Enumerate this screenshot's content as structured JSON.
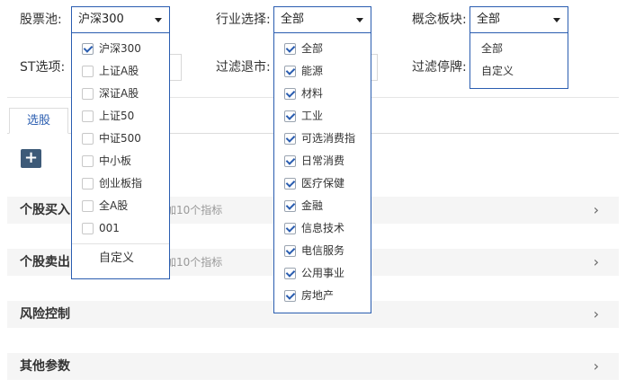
{
  "filters": {
    "pool_label": "股票池:",
    "pool_value": "沪深300",
    "industry_label": "行业选择:",
    "industry_value": "全部",
    "concept_label": "概念板块:",
    "concept_value": "全部",
    "st_label": "ST选项:",
    "delist_label": "过滤退市:",
    "suspend_label": "过滤停牌:"
  },
  "pool_menu": {
    "options": [
      {
        "label": "沪深300",
        "checked": true
      },
      {
        "label": "上证A股",
        "checked": false
      },
      {
        "label": "深证A股",
        "checked": false
      },
      {
        "label": "上证50",
        "checked": false
      },
      {
        "label": "中证500",
        "checked": false
      },
      {
        "label": "中小板",
        "checked": false
      },
      {
        "label": "创业板指",
        "checked": false
      },
      {
        "label": "全A股",
        "checked": false
      },
      {
        "label": "001",
        "checked": false
      }
    ],
    "custom_label": "自定义"
  },
  "industry_menu": {
    "options": [
      {
        "label": "全部",
        "checked": true
      },
      {
        "label": "能源",
        "checked": true
      },
      {
        "label": "材料",
        "checked": true
      },
      {
        "label": "工业",
        "checked": true
      },
      {
        "label": "可选消费指",
        "checked": true
      },
      {
        "label": "日常消费",
        "checked": true
      },
      {
        "label": "医疗保健",
        "checked": true
      },
      {
        "label": "金融",
        "checked": true
      },
      {
        "label": "信息技术",
        "checked": true
      },
      {
        "label": "电信服务",
        "checked": true
      },
      {
        "label": "公用事业",
        "checked": true
      },
      {
        "label": "房地产",
        "checked": true
      }
    ]
  },
  "concept_menu": {
    "options": [
      "全部",
      "自定义"
    ]
  },
  "tabs": [
    {
      "label": "选股"
    }
  ],
  "add_button": "+",
  "sections": [
    {
      "title": "个股买入",
      "hint": "加10个指标",
      "chevron": "›"
    },
    {
      "title": "个股卖出",
      "hint": "加10个指标",
      "chevron": "›"
    },
    {
      "title": "风险控制",
      "hint": "",
      "chevron": "›"
    },
    {
      "title": "其他参数",
      "hint": "",
      "chevron": "›"
    }
  ]
}
